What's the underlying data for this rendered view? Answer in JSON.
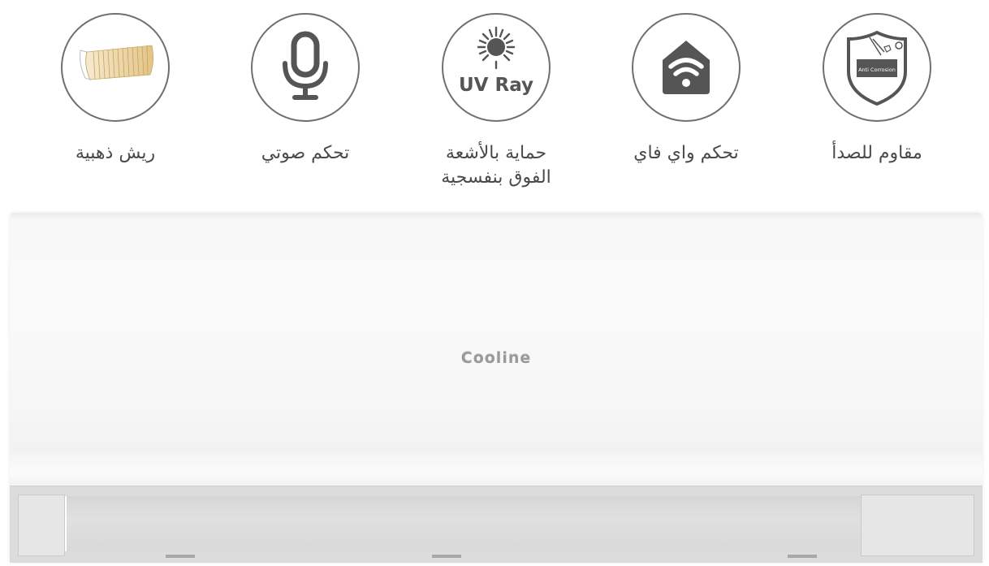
{
  "features": [
    {
      "label": "ريش ذهبية",
      "icon": "golden-fins-icon"
    },
    {
      "label": "تحكم صوتي",
      "icon": "microphone-icon"
    },
    {
      "label": "حماية بالأشعة\nالفوق بنفسجية",
      "icon": "uv-ray-icon",
      "icon_text": "UV Ray"
    },
    {
      "label": "تحكم واي فاي",
      "icon": "wifi-home-icon"
    },
    {
      "label": "مقاوم للصدأ",
      "icon": "anti-corrosion-shield-icon",
      "icon_text": "Anti Corrosion"
    }
  ],
  "product": {
    "brand": "Cooline"
  },
  "colors": {
    "icon_stroke": "#6f6f6f",
    "icon_fill": "#555555",
    "label_text": "#4a4a4a",
    "fin_gold": "#e8c98a"
  }
}
